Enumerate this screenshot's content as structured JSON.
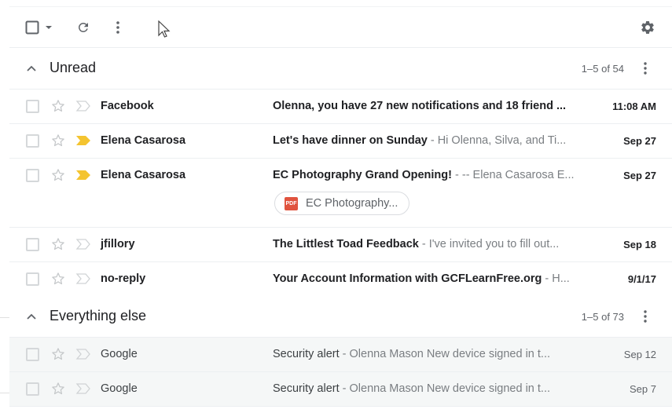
{
  "toolbar": {
    "select_icon": "checkbox-icon",
    "select_dropdown_icon": "caret-down-icon",
    "refresh_icon": "refresh-icon",
    "more_icon": "more-vert-icon",
    "settings_icon": "gear-icon"
  },
  "sections": [
    {
      "title": "Unread",
      "count": "1–5 of 54",
      "rows": [
        {
          "sender": "Facebook",
          "subject": "Olenna, you have 27 new notifications and 18 friend ...",
          "snippet": "",
          "date": "11:08 AM",
          "important": false
        },
        {
          "sender": "Elena Casarosa",
          "subject": "Let's have dinner on Sunday",
          "snippet": " - Hi Olenna, Silva, and Ti...",
          "date": "Sep 27",
          "important": true
        },
        {
          "sender": "Elena Casarosa",
          "subject": "EC Photography Grand Opening!",
          "snippet": " - -- Elena Casarosa E...",
          "date": "Sep 27",
          "important": true,
          "attachment": {
            "type": "PDF",
            "name": "EC Photography..."
          }
        },
        {
          "sender": "jfillory",
          "subject": "The Littlest Toad Feedback",
          "snippet": " - I've invited you to fill out...",
          "date": "Sep 18",
          "important": false
        },
        {
          "sender": "no-reply",
          "subject": "Your Account Information with GCFLearnFree.org",
          "snippet": " - H...",
          "date": "9/1/17",
          "important": false
        }
      ]
    },
    {
      "title": "Everything else",
      "count": "1–5 of 73",
      "rows": [
        {
          "sender": "Google",
          "subject": "Security alert",
          "snippet": " - Olenna Mason New device signed in t...",
          "date": "Sep 12",
          "important": false
        },
        {
          "sender": "Google",
          "subject": "Security alert",
          "snippet": " - Olenna Mason New device signed in t...",
          "date": "Sep 7",
          "important": false
        }
      ]
    }
  ],
  "colors": {
    "important_marker": "#f4c430",
    "pdf_badge": "#e0533e",
    "read_row_bg": "#f5f7f7"
  }
}
